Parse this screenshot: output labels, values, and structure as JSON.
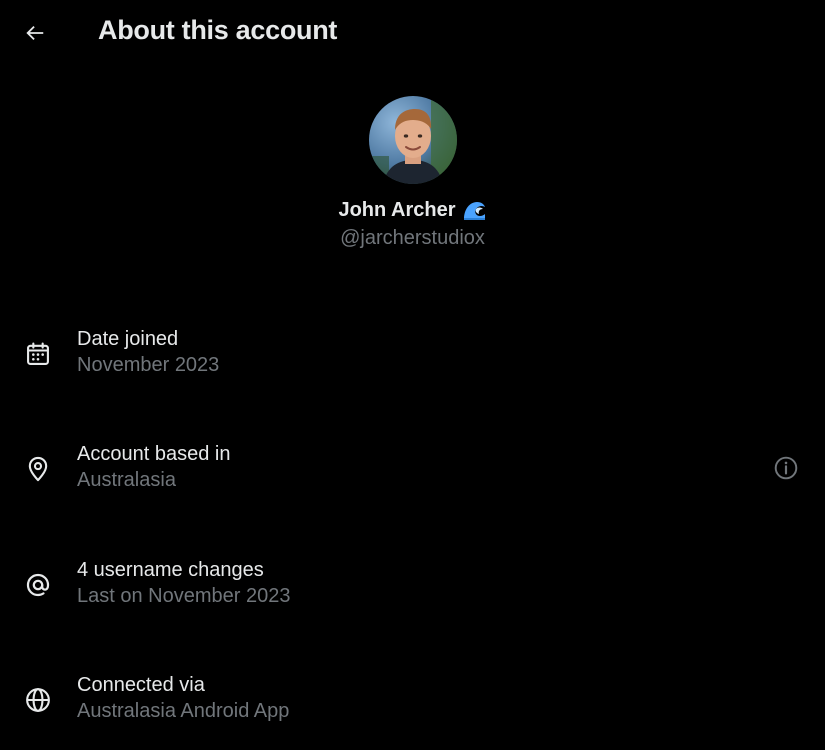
{
  "header": {
    "title": "About this account",
    "back_icon": "arrow-left-icon"
  },
  "profile": {
    "display_name": "John Archer",
    "badge_icon": "water-wave-emoji-icon",
    "handle": "@jarcherstudiox",
    "avatar_icon": "profile-photo"
  },
  "info": {
    "date_joined": {
      "label": "Date joined",
      "value": "November 2023",
      "icon": "calendar-icon"
    },
    "based_in": {
      "label": "Account based in",
      "value": "Australasia",
      "icon": "location-pin-icon",
      "detail_icon": "info-circle-icon"
    },
    "username_changes": {
      "label": "4 username changes",
      "value": "Last on November 2023",
      "icon": "at-sign-icon"
    },
    "connected_via": {
      "label": "Connected via",
      "value": "Australasia Android App",
      "icon": "globe-icon"
    }
  },
  "colors": {
    "background": "#000000",
    "primary_text": "#e7e9ea",
    "secondary_text": "#71767b",
    "wave_accent": "#4aa3ff"
  }
}
